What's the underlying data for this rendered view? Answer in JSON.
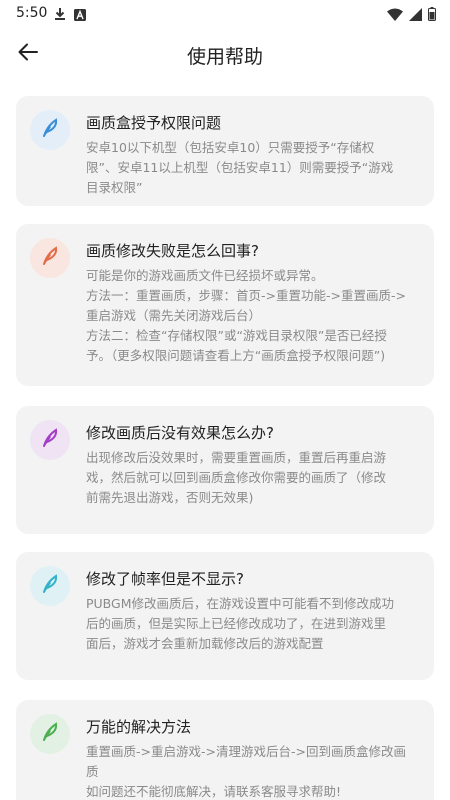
{
  "status_bar": {
    "time": "5:50",
    "icons": [
      "download-icon",
      "a-badge-icon",
      "wifi-icon",
      "signal-icon",
      "battery-icon"
    ]
  },
  "app_bar": {
    "back_icon": "arrow-left-icon",
    "title": "使用帮助"
  },
  "colors": {
    "card_bg": "#f3f3f3",
    "title_text": "#222222",
    "body_text": "#8a8a8a"
  },
  "cards": [
    {
      "title": "画质盒授予权限问题",
      "icon_color": "#3a8fd6",
      "icon_bg": "#e3eef9",
      "lines": [
        "安卓10以下机型（包括安卓10）只需要授予“存储权",
        "限”、安卓11以上机型（包括安卓11）则需要授予“游戏",
        "目录权限”"
      ]
    },
    {
      "title": "画质修改失败是怎么回事?",
      "icon_color": "#e36d4a",
      "icon_bg": "#f9e6e0",
      "lines": [
        "可能是你的游戏画质文件已经损坏或异常。",
        "方法一：重置画质，步骤：首页->重置功能->重置画质->",
        "重启游戏（需先关闭游戏后台）",
        "方法二：检查“存储权限”或“游戏目录权限”是否已经授",
        "予。（更多权限问题请查看上方“画质盒授予权限问题”)"
      ]
    },
    {
      "title": "修改画质后没有效果怎么办?",
      "icon_color": "#a33fc7",
      "icon_bg": "#efe3f4",
      "lines": [
        "出现修改后没效果时，需要重置画质，重置后再重启游",
        "戏，然后就可以回到画质盒修改你需要的画质了（修改",
        "前需先退出游戏，否则无效果)"
      ]
    },
    {
      "title": "修改了帧率但是不显示?",
      "icon_color": "#33b3c9",
      "icon_bg": "#dff1f4",
      "lines": [
        "PUBGM修改画质后，在游戏设置中可能看不到修改成功",
        "后的画质，但是实际上已经修改成功了，在进到游戏里",
        "面后，游戏才会重新加载修改后的游戏配置"
      ]
    },
    {
      "title": "万能的解决方法",
      "icon_color": "#4caf50",
      "icon_bg": "#e2f1e3",
      "lines": [
        "重置画质->重启游戏->清理游戏后台->回到画质盒修改画",
        "质",
        "如问题还不能彻底解决，请联系客服寻求帮助!"
      ]
    }
  ]
}
